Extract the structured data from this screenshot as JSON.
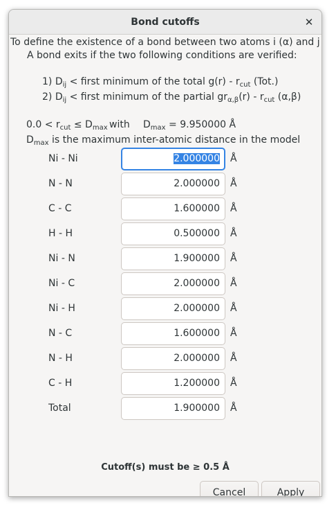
{
  "window": {
    "title": "Bond cutoffs"
  },
  "intro": {
    "line1": "To define the existence of a bond between two atoms i (α) and j (β).",
    "line2": "A bond exits if the two following conditions are verified:"
  },
  "conditions": {
    "c1_prefix": "1) D",
    "c1_sub": "ij",
    "c1_mid": " < first minimum of the total g(r) - r",
    "c1_sub2": "cut",
    "c1_suffix": " (Tot.)",
    "c2_prefix": "2) D",
    "c2_sub": "ij",
    "c2_mid": " < first minimum of the partial gr",
    "c2_sub2": "α,β",
    "c2_mid2": "(r) - r",
    "c2_sub3": "cut",
    "c2_suffix": " (α,β)"
  },
  "range": {
    "r_prefix": "0.0 < r",
    "r_sub": "cut",
    "r_mid": " ≤ D",
    "r_sub2": "max",
    "r_with": "with",
    "dmax_prefix": "D",
    "dmax_sub": "max",
    "dmax_value": " = 9.950000 Å",
    "desc_prefix": "D",
    "desc_sub": "max",
    "desc_suffix": " is the maximum inter-atomic distance in the model"
  },
  "rows": [
    {
      "label": "Ni - Ni",
      "value": "2.000000",
      "unit": "Å"
    },
    {
      "label": "N - N",
      "value": "2.000000",
      "unit": "Å"
    },
    {
      "label": "C - C",
      "value": "1.600000",
      "unit": "Å"
    },
    {
      "label": "H - H",
      "value": "0.500000",
      "unit": "Å"
    },
    {
      "label": "Ni - N",
      "value": "1.900000",
      "unit": "Å"
    },
    {
      "label": "Ni - C",
      "value": "2.000000",
      "unit": "Å"
    },
    {
      "label": "Ni - H",
      "value": "2.000000",
      "unit": "Å"
    },
    {
      "label": "N - C",
      "value": "1.600000",
      "unit": "Å"
    },
    {
      "label": "N - H",
      "value": "2.000000",
      "unit": "Å"
    },
    {
      "label": "C - H",
      "value": "1.200000",
      "unit": "Å"
    },
    {
      "label": "Total",
      "value": "1.900000",
      "unit": "Å"
    }
  ],
  "warning": "Cutoff(s) must be ≥ 0.5 Å",
  "buttons": {
    "cancel": "Cancel",
    "apply": "Apply"
  },
  "icons": {
    "close": "close-icon"
  },
  "colors": {
    "focus": "#3584e4",
    "window_bg": "#f6f5f4"
  }
}
